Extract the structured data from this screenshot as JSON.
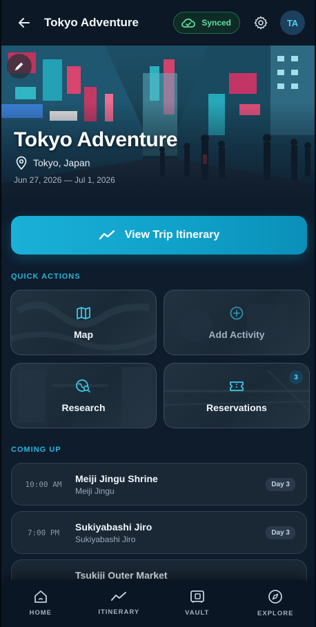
{
  "header": {
    "title": "Tokyo Adventure",
    "sync_label": "Synced",
    "avatar_initials": "TA",
    "icons": [
      "back-arrow-icon",
      "cloud-check-icon",
      "gear-icon"
    ]
  },
  "hero": {
    "title": "Tokyo Adventure",
    "location": "Tokyo, Japan",
    "dates": "Jun 27, 2026 — Jul 1, 2026",
    "icons": [
      "pencil-icon",
      "map-pin-icon"
    ]
  },
  "cta": {
    "label": "View Trip Itinerary",
    "icon": "trend-line-icon"
  },
  "quick_actions": {
    "label": "QUICK ACTIONS",
    "items": [
      {
        "label": "Map",
        "icon": "map-icon"
      },
      {
        "label": "Add Activity",
        "icon": "plus-circle-icon"
      },
      {
        "label": "Research",
        "icon": "globe-search-icon"
      },
      {
        "label": "Reservations",
        "icon": "ticket-icon",
        "badge": "3"
      }
    ]
  },
  "coming_up": {
    "label": "COMING UP",
    "events": [
      {
        "time": "10:00 AM",
        "name": "Meiji Jingu Shrine",
        "place": "Meiji Jingu",
        "day": "Day 3"
      },
      {
        "time": "7:00 PM",
        "name": "Sukiyabashi Jiro",
        "place": "Sukiyabashi Jiro",
        "day": "Day 3"
      },
      {
        "time": "",
        "name": "Tsukiji Outer Market",
        "place": "",
        "day": ""
      }
    ]
  },
  "bottom_nav": {
    "items": [
      {
        "label": "HOME",
        "icon": "home-icon"
      },
      {
        "label": "ITINERARY",
        "icon": "trend-line-icon"
      },
      {
        "label": "VAULT",
        "icon": "vault-icon"
      },
      {
        "label": "EXPLORE",
        "icon": "compass-icon"
      }
    ]
  },
  "colors": {
    "accent": "#1ab0d8",
    "background": "#0e1c2c",
    "synced": "#5fe0a0"
  }
}
